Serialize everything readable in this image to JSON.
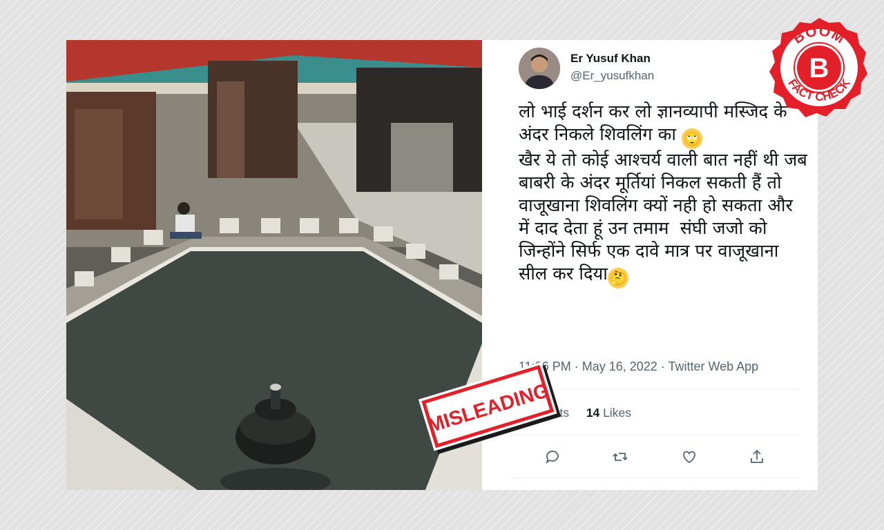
{
  "tweet": {
    "author_name": "Er Yusuf Khan",
    "author_handle": "@Er_yusufkhan",
    "text_line_1": "लो भाई दर्शन कर लो ज्ञानव्यापी मस्जिद के अंदर निकले शिवलिंग का ",
    "emoji_1": "🙄",
    "text_line_2": "खैर ये तो कोई आश्चर्य वाली बात नहीं थी जब बाबरी के अंदर मूर्तियां निकल सकती हैं तो वाजूखाना शिवलिंग क्यों नही हो सकता और में दाद देता हूं उन तमाम  संघी जजो को जिन्होंने सिर्फ एक दावे मात्र पर वाजूखाना सील कर दिया",
    "emoji_2": "🤔",
    "timestamp": "11:36 PM · May 16, 2022 · Twitter Web App",
    "retweets_count": "",
    "retweets_label": "Retweets",
    "likes_count": "14",
    "likes_label": "Likes"
  },
  "actions": [
    {
      "icon": "reply-icon"
    },
    {
      "icon": "retweet-icon"
    },
    {
      "icon": "like-icon"
    },
    {
      "icon": "share-icon"
    }
  ],
  "stamp": {
    "label": "MISLEADING",
    "color": "#e3202a"
  },
  "badge": {
    "top_text": "BOOM",
    "letter": "B",
    "bottom_text": "FACT CHECK",
    "color": "#e3202a"
  },
  "colors": {
    "twitter_text": "#0f1419",
    "twitter_muted": "#536471",
    "boom_red": "#e3202a"
  }
}
